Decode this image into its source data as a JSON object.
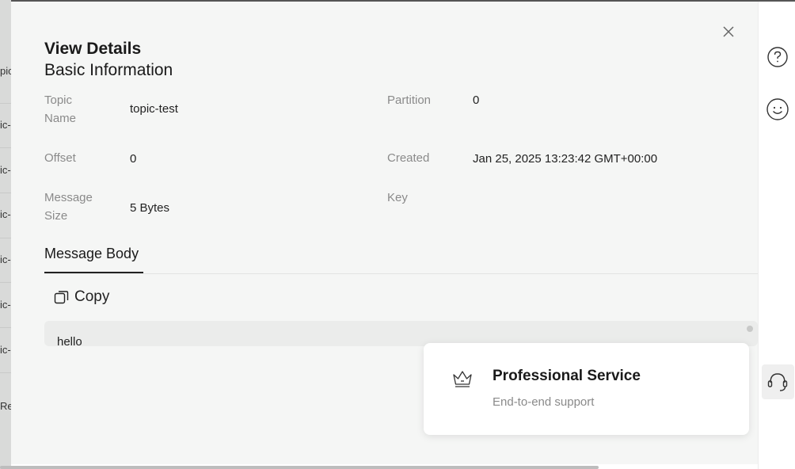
{
  "background": {
    "rows": [
      "pic",
      "ic-",
      "ic-",
      "ic-",
      "ic-",
      "ic-",
      "ic-",
      "Re"
    ]
  },
  "drawer": {
    "title": "View Details",
    "subtitle": "Basic Information",
    "fields": {
      "topic_name_label_1": "Topic",
      "topic_name_label_2": "Name",
      "topic_name_value": "topic-test",
      "partition_label": "Partition",
      "partition_value": "0",
      "offset_label": "Offset",
      "offset_value": "0",
      "created_label": "Created",
      "created_value": "Jan 25, 2025 13:23:42 GMT+00:00",
      "message_size_label_1": "Message",
      "message_size_label_2": "Size",
      "message_size_value": "5 Bytes",
      "key_label": "Key",
      "key_value": ""
    },
    "tab_label": "Message Body",
    "copy_label": "Copy",
    "message_body": "hello"
  },
  "popup": {
    "title": "Professional Service",
    "subtitle": "End-to-end support"
  },
  "icons": {
    "close": "close-icon",
    "help": "help-circle-icon",
    "feedback": "smiley-icon",
    "support": "headset-icon",
    "crown": "crown-icon",
    "copy": "copy-icon"
  }
}
